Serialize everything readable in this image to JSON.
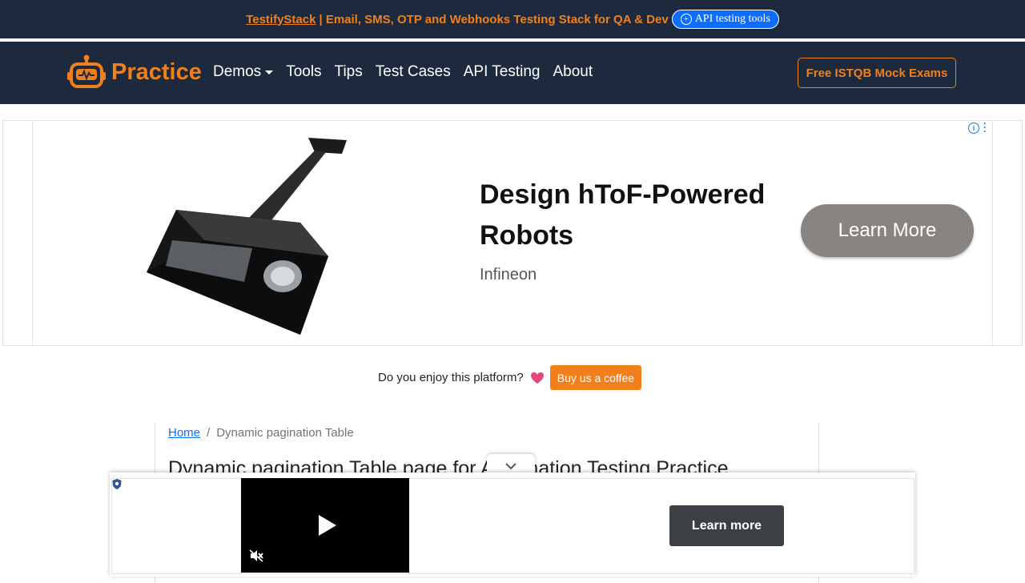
{
  "topbar": {
    "brand": "TestifyStack",
    "tagline": "| Email, SMS, OTP and Webhooks Testing Stack for QA & Dev",
    "api_button": "API testing tools"
  },
  "navbar": {
    "logo_text": "Practice",
    "links": [
      {
        "label": "Demos",
        "has_dropdown": true
      },
      {
        "label": "Tools"
      },
      {
        "label": "Tips"
      },
      {
        "label": "Test Cases"
      },
      {
        "label": "API Testing"
      },
      {
        "label": "About"
      }
    ],
    "cta": "Free ISTQB Mock Exams"
  },
  "ad_banner": {
    "headline": "Design hToF-Powered Robots",
    "advertiser": "Infineon",
    "cta": "Learn More"
  },
  "coffee": {
    "question": "Do you enjoy this platform?",
    "button": "Buy us a coffee"
  },
  "content": {
    "breadcrumb_home": "Home",
    "breadcrumb_sep": "/",
    "breadcrumb_current": "Dynamic pagination Table",
    "title": "Dynamic pagination Table page for Automation Testing Practice"
  },
  "video_ad": {
    "cta": "Learn more"
  },
  "colors": {
    "navy": "#1d2a3d",
    "accent_orange": "#f07f1c",
    "link_blue": "#0d6efd"
  }
}
